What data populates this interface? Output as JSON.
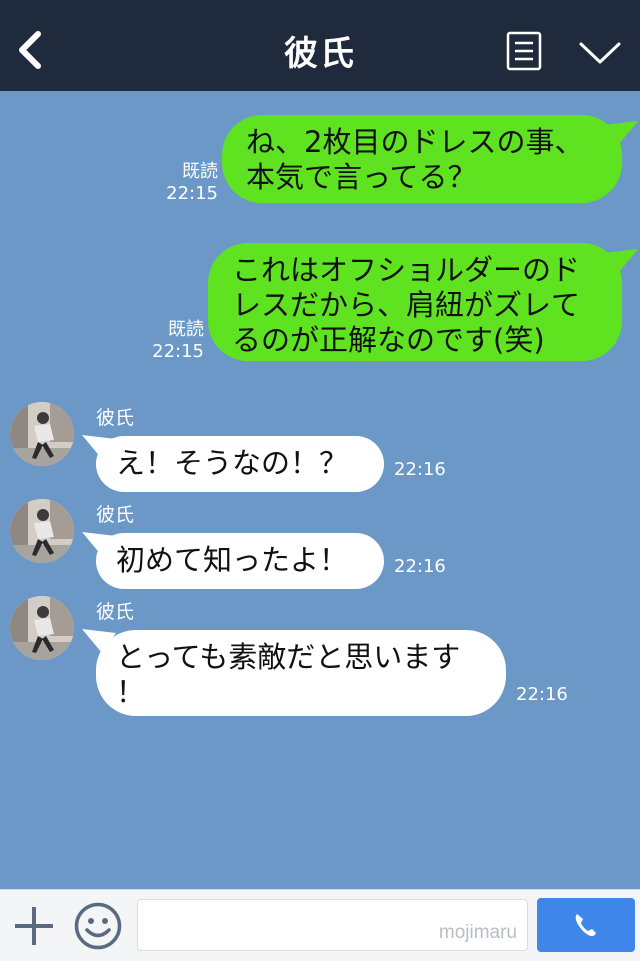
{
  "header": {
    "title": "彼氏",
    "back_icon": "chevron-left-icon",
    "menu_icon": "menu-lines-icon",
    "expand_icon": "chevron-down-icon",
    "background": "#1f2a3d"
  },
  "chat": {
    "background": "#6b98c7",
    "sent_bubble_color": "#5fe321",
    "received_bubble_color": "#ffffff",
    "messages": [
      {
        "direction": "sent",
        "lines": [
          "ね、2枚目のドレスの事、",
          "本気で言ってる？"
        ],
        "read_label": "既読",
        "time": "22:15"
      },
      {
        "direction": "sent",
        "lines": [
          "これはオフショルダーのド",
          "レスだから、肩紐がズレて",
          "るのが正解なのです(笑)"
        ],
        "read_label": "既読",
        "time": "22:15"
      },
      {
        "direction": "received",
        "sender": "彼氏",
        "lines": [
          "え！そうなの！？"
        ],
        "time": "22:16"
      },
      {
        "direction": "received",
        "sender": "彼氏",
        "lines": [
          "初めて知ったよ！"
        ],
        "time": "22:16"
      },
      {
        "direction": "received",
        "sender": "彼氏",
        "lines": [
          "とっても素敵だと思います",
          "！"
        ],
        "time": "22:16"
      }
    ]
  },
  "footer": {
    "plus_icon": "plus-icon",
    "emoji_icon": "smiley-icon",
    "input_value": "",
    "watermark": "mojimaru",
    "call_icon": "phone-icon",
    "call_color": "#3e86e8"
  }
}
